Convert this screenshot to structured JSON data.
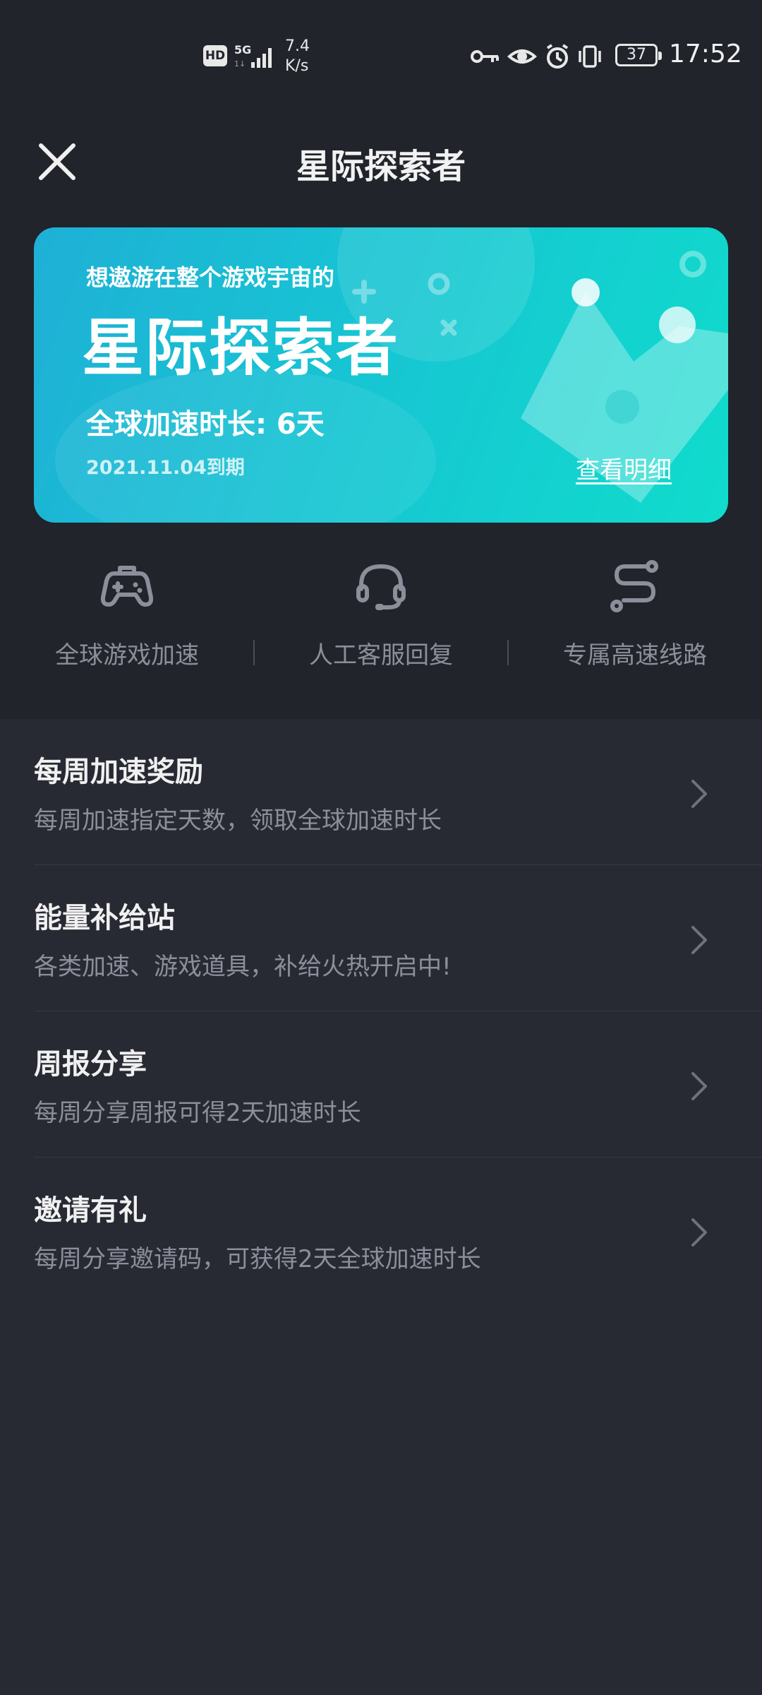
{
  "status_bar": {
    "hd": "HD",
    "network": "5G",
    "speed_value": "7.4",
    "speed_unit": "K/s",
    "battery": "37",
    "time": "17:52"
  },
  "header": {
    "title": "星际探索者"
  },
  "banner": {
    "subtitle": "想遨游在整个游戏宇宙的",
    "title": "星际探索者",
    "duration": "全球加速时长: 6天",
    "expiry": "2021.11.04到期",
    "detail_link": "查看明细"
  },
  "features": [
    {
      "icon": "gamepad-icon",
      "label": "全球游戏加速"
    },
    {
      "icon": "headset-icon",
      "label": "人工客服回复"
    },
    {
      "icon": "route-icon",
      "label": "专属高速线路"
    }
  ],
  "list": [
    {
      "title": "每周加速奖励",
      "desc": "每周加速指定天数，领取全球加速时长"
    },
    {
      "title": "能量补给站",
      "desc": "各类加速、游戏道具，补给火热开启中!"
    },
    {
      "title": "周报分享",
      "desc": "每周分享周报可得2天加速时长"
    },
    {
      "title": "邀请有礼",
      "desc": "每周分享邀请码，可获得2天全球加速时长"
    }
  ],
  "colors": {
    "background": "#282a33",
    "header_background": "#22242c",
    "banner_start": "#1fb0d6",
    "banner_end": "#10dccc",
    "secondary_text": "#8c8f99"
  }
}
